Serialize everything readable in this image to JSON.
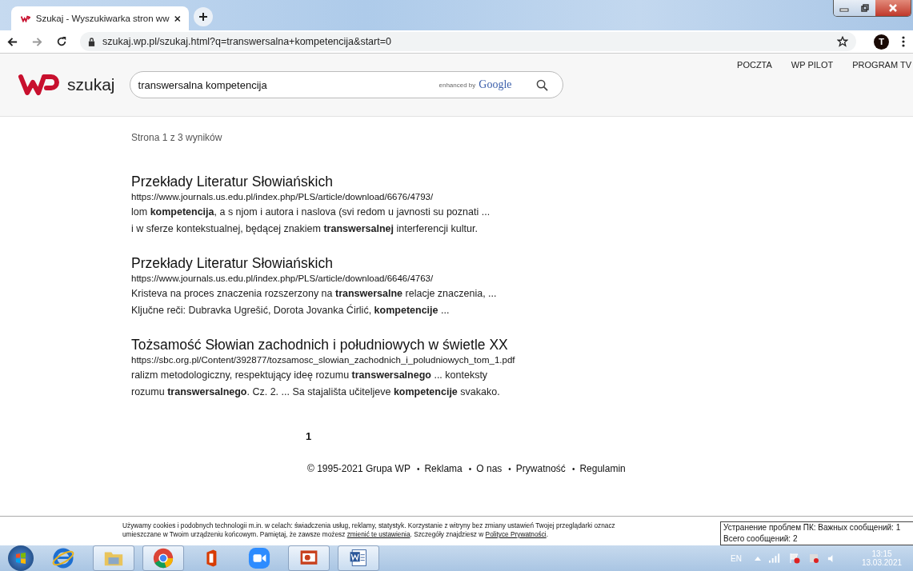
{
  "browser": {
    "tab_title": "Szukaj - Wyszukiwarka stron ww",
    "url": "szukaj.wp.pl/szukaj.html?q=transwersalna+kompetencija&start=0",
    "avatar": "T"
  },
  "header": {
    "logo_text": "szukaj",
    "search_value": "transwersalna kompetencija",
    "enhanced_by": "enhanced by",
    "google": "Google",
    "nav": [
      "POCZTA",
      "WP PILOT",
      "PROGRAM TV"
    ]
  },
  "results_info": "Strona 1 z 3 wyników",
  "results": [
    {
      "title": "Przekłady Literatur Słowiańskich",
      "url": "https://www.journals.us.edu.pl/index.php/PLS/article/download/6676/4793/",
      "snippet": [
        "lom **kompetencija**, a s njom i autora i naslova (svi redom u javnosti su poznati ...",
        "i w sferze kontekstualnej, będącej znakiem **transwersalnej** interferencji kultur."
      ]
    },
    {
      "title": "Przekłady Literatur Słowiańskich",
      "url": "https://www.journals.us.edu.pl/index.php/PLS/article/download/6646/4763/",
      "snippet": [
        "Kristeva na proces znaczenia rozszerzony na **transwersalne** relacje znaczenia, ...",
        "Ključne reči: Dubravka Ugrešić, Dorota Jovanka Ćirlić, **kompetencije** ..."
      ]
    },
    {
      "title": "Tożsamość Słowian zachodnich i południowych w świetle XX",
      "url": "https://sbc.org.pl/Content/392877/tozsamosc_slowian_zachodnich_i_poludniowych_tom_1.pdf",
      "snippet": [
        "ralizm metodologiczny, respektujący ideę rozumu **transwersalnego** ... konteksty",
        "rozumu **transwersalnego**. Cz. 2. ... Sa stajališta učiteljeve **kompetencije** svakako."
      ]
    }
  ],
  "pagination": [
    {
      "label": "1",
      "selected": true
    }
  ],
  "footer": {
    "copyright": "© 1995-2021 Grupa WP",
    "separator": "•",
    "links": [
      "Reklama",
      "O nas",
      "Prywatność",
      "Regulamin"
    ]
  },
  "cookie_notice": [
    [
      {
        "kind": "text",
        "text": "Używamy cookies i podobnych technologii m.in. w celach: świadczenia usług, reklamy, statystyk. Korzystanie z witryny bez zmiany ustawień Twojej przeglądarki oznacz"
      }
    ],
    [
      {
        "kind": "text",
        "text": "umieszczane w Twoim urządzeniu końcowym. Pamiętaj, że zawsze możesz "
      },
      {
        "kind": "link",
        "text": "zmienić te ustawienia"
      },
      {
        "kind": "text",
        "text": ". Szczegóły znajdziesz w "
      },
      {
        "kind": "link",
        "text": "Polityce Prywatności"
      },
      {
        "kind": "text",
        "text": "."
      }
    ]
  ],
  "tooltip": [
    "Устранение проблем ПК: Важных сообщений: 1",
    "Всего сообщений: 2"
  ],
  "taskbar": {
    "apps": [
      {
        "kind": "ie"
      },
      {
        "kind": "folder"
      },
      {
        "kind": "chrome"
      },
      {
        "kind": "office"
      },
      {
        "kind": "zoom"
      },
      {
        "kind": "powerpoint"
      },
      {
        "kind": "word"
      }
    ],
    "language": "EN",
    "time": "13:15",
    "date": "13.03.2021"
  }
}
